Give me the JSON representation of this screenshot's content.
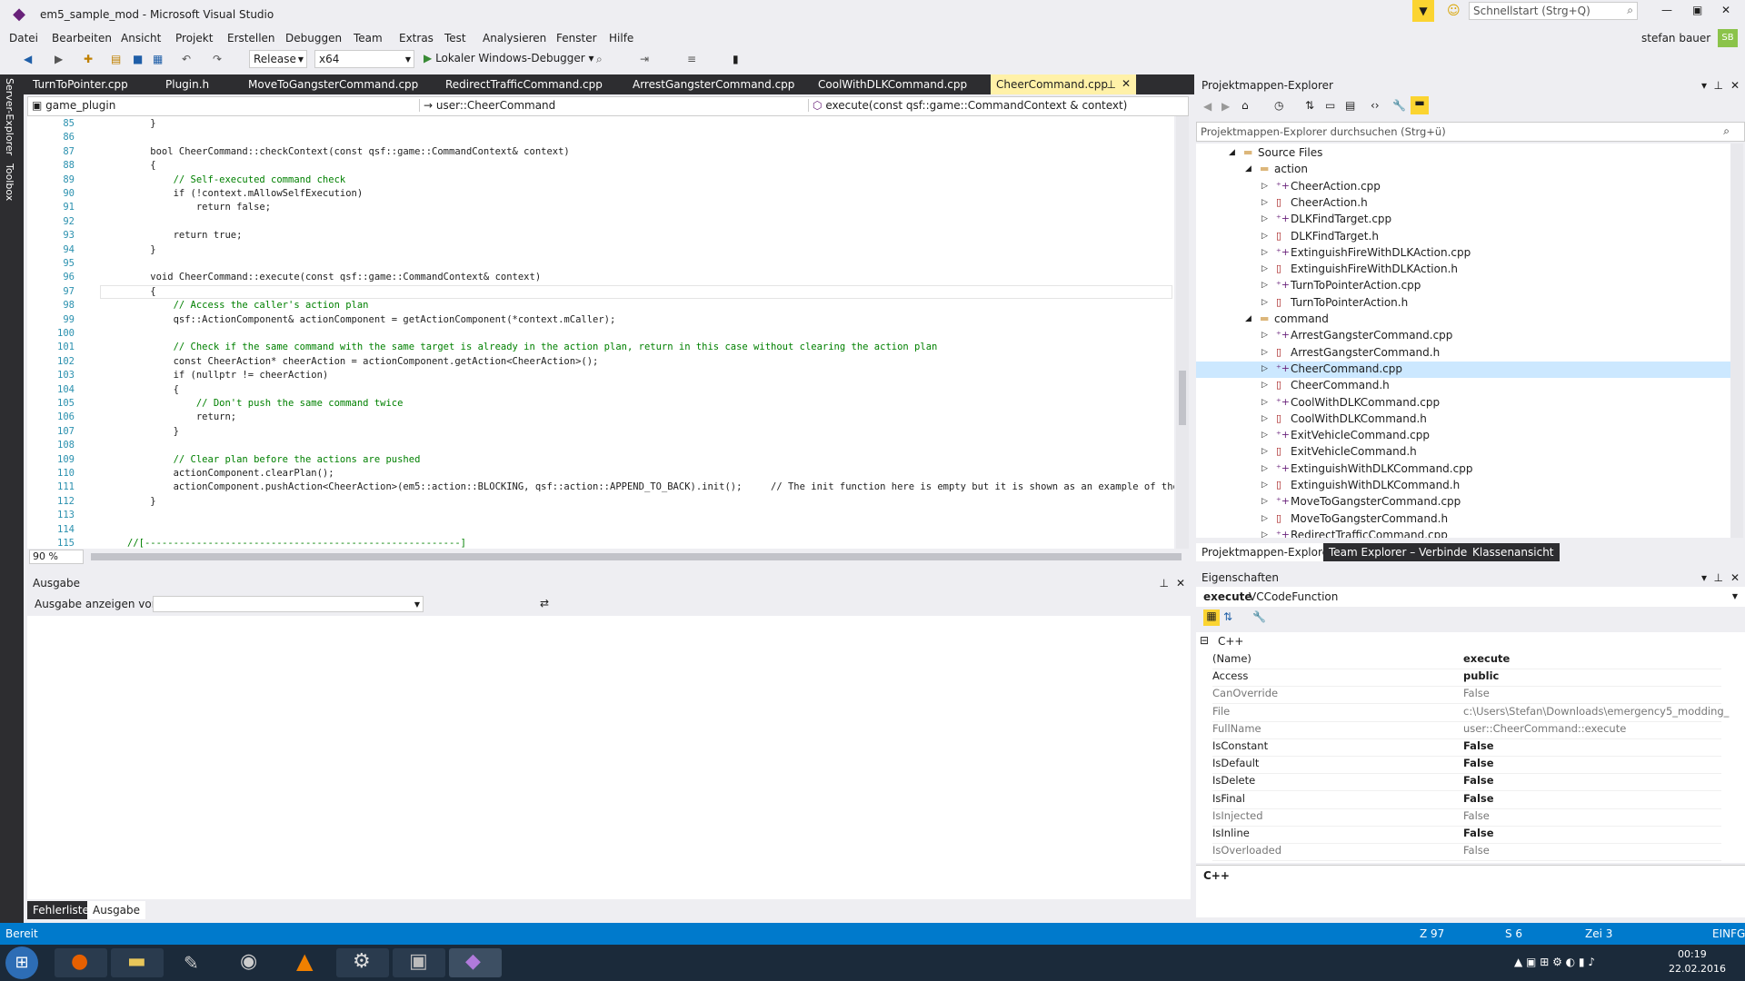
{
  "window": {
    "title": "em5_sample_mod - Microsoft Visual Studio",
    "quicklaunch": "Schnellstart (Strg+Q)",
    "user": "stefan bauer",
    "user_initials": "SB"
  },
  "menu": [
    "Datei",
    "Bearbeiten",
    "Ansicht",
    "Projekt",
    "Erstellen",
    "Debuggen",
    "Team",
    "Extras",
    "Test",
    "Analysieren",
    "Fenster",
    "Hilfe"
  ],
  "toolbar": {
    "config": "Release",
    "platform": "x64",
    "debugger": "Lokaler Windows-Debugger"
  },
  "sidestrip": {
    "server_explorer": "Server-Explorer",
    "toolbox": "Toolbox"
  },
  "tabs": [
    "TurnToPointer.cpp",
    "Plugin.h",
    "MoveToGangsterCommand.cpp",
    "RedirectTrafficCommand.cpp",
    "ArrestGangsterCommand.cpp",
    "CoolWithDLKCommand.cpp"
  ],
  "active_tab": "CheerCommand.cpp",
  "nav": {
    "project": "game_plugin",
    "scope": "user::CheerCommand",
    "member": "execute(const qsf::game::CommandContext & context)"
  },
  "code": [
    {
      "n": "85",
      "t": "    }"
    },
    {
      "n": "86",
      "t": ""
    },
    {
      "n": "87",
      "t": "    bool CheerCommand::checkContext(const qsf::game::CommandContext& context)"
    },
    {
      "n": "88",
      "t": "    {"
    },
    {
      "n": "89",
      "t": "        // Self-executed command check"
    },
    {
      "n": "90",
      "t": "        if (!context.mAllowSelfExecution)"
    },
    {
      "n": "91",
      "t": "            return false;"
    },
    {
      "n": "92",
      "t": ""
    },
    {
      "n": "93",
      "t": "        return true;"
    },
    {
      "n": "94",
      "t": "    }"
    },
    {
      "n": "95",
      "t": ""
    },
    {
      "n": "96",
      "t": "    void CheerCommand::execute(const qsf::game::CommandContext& context)"
    },
    {
      "n": "97",
      "t": "    {"
    },
    {
      "n": "98",
      "t": "        // Access the caller's action plan"
    },
    {
      "n": "99",
      "t": "        qsf::ActionComponent& actionComponent = getActionComponent(*context.mCaller);"
    },
    {
      "n": "100",
      "t": ""
    },
    {
      "n": "101",
      "t": "        // Check if the same command with the same target is already in the action plan, return in this case without clearing the action plan"
    },
    {
      "n": "102",
      "t": "        const CheerAction* cheerAction = actionComponent.getAction<CheerAction>();"
    },
    {
      "n": "103",
      "t": "        if (nullptr != cheerAction)"
    },
    {
      "n": "104",
      "t": "        {"
    },
    {
      "n": "105",
      "t": "            // Don't push the same command twice"
    },
    {
      "n": "106",
      "t": "            return;"
    },
    {
      "n": "107",
      "t": "        }"
    },
    {
      "n": "108",
      "t": ""
    },
    {
      "n": "109",
      "t": "        // Clear plan before the actions are pushed"
    },
    {
      "n": "110",
      "t": "        actionComponent.clearPlan();"
    },
    {
      "n": "111",
      "t": "        actionComponent.pushAction<CheerAction>(em5::action::BLOCKING, qsf::action::APPEND_TO_BACK).init();     // The init function here is empty but it is shown as an example of the"
    },
    {
      "n": "112",
      "t": "    }"
    },
    {
      "n": "113",
      "t": ""
    },
    {
      "n": "114",
      "t": ""
    },
    {
      "n": "115",
      "t": "//[-------------------------------------------------------]"
    }
  ],
  "zoom": "90 %",
  "output": {
    "title": "Ausgabe",
    "show_from": "Ausgabe anzeigen von:"
  },
  "bottom_tabs": [
    "Fehlerliste",
    "Ausgabe"
  ],
  "solution": {
    "title": "Projektmappen-Explorer",
    "search": "Projektmappen-Explorer durchsuchen (Strg+ü)",
    "tree": [
      {
        "label": "Source Files",
        "lvl": 1,
        "kind": "folder",
        "open": true
      },
      {
        "label": "action",
        "lvl": 2,
        "kind": "folder",
        "open": true
      },
      {
        "label": "CheerAction.cpp",
        "lvl": 3,
        "kind": "cpp"
      },
      {
        "label": "CheerAction.h",
        "lvl": 3,
        "kind": "h"
      },
      {
        "label": "DLKFindTarget.cpp",
        "lvl": 3,
        "kind": "cpp"
      },
      {
        "label": "DLKFindTarget.h",
        "lvl": 3,
        "kind": "h"
      },
      {
        "label": "ExtinguishFireWithDLKAction.cpp",
        "lvl": 3,
        "kind": "cpp"
      },
      {
        "label": "ExtinguishFireWithDLKAction.h",
        "lvl": 3,
        "kind": "h"
      },
      {
        "label": "TurnToPointerAction.cpp",
        "lvl": 3,
        "kind": "cpp"
      },
      {
        "label": "TurnToPointerAction.h",
        "lvl": 3,
        "kind": "h"
      },
      {
        "label": "command",
        "lvl": 2,
        "kind": "folder",
        "open": true
      },
      {
        "label": "ArrestGangsterCommand.cpp",
        "lvl": 3,
        "kind": "cpp"
      },
      {
        "label": "ArrestGangsterCommand.h",
        "lvl": 3,
        "kind": "h"
      },
      {
        "label": "CheerCommand.cpp",
        "lvl": 3,
        "kind": "cpp",
        "selected": true
      },
      {
        "label": "CheerCommand.h",
        "lvl": 3,
        "kind": "h"
      },
      {
        "label": "CoolWithDLKCommand.cpp",
        "lvl": 3,
        "kind": "cpp"
      },
      {
        "label": "CoolWithDLKCommand.h",
        "lvl": 3,
        "kind": "h"
      },
      {
        "label": "ExitVehicleCommand.cpp",
        "lvl": 3,
        "kind": "cpp"
      },
      {
        "label": "ExitVehicleCommand.h",
        "lvl": 3,
        "kind": "h"
      },
      {
        "label": "ExtinguishWithDLKCommand.cpp",
        "lvl": 3,
        "kind": "cpp"
      },
      {
        "label": "ExtinguishWithDLKCommand.h",
        "lvl": 3,
        "kind": "h"
      },
      {
        "label": "MoveToGangsterCommand.cpp",
        "lvl": 3,
        "kind": "cpp"
      },
      {
        "label": "MoveToGangsterCommand.h",
        "lvl": 3,
        "kind": "h"
      },
      {
        "label": "RedirectTrafficCommand.cpp",
        "lvl": 3,
        "kind": "cpp"
      }
    ],
    "tabs": [
      "Projektmappen-Explorer",
      "Team Explorer – Verbinden",
      "Klassenansicht"
    ]
  },
  "properties": {
    "title": "Eigenschaften",
    "object": "execute",
    "object_type": "VCCodeFunction",
    "category": "C++",
    "rows": [
      {
        "name": "(Name)",
        "value": "execute",
        "bold": true
      },
      {
        "name": "Access",
        "value": "public",
        "bold": true
      },
      {
        "name": "CanOverride",
        "value": "False",
        "bold": false
      },
      {
        "name": "File",
        "value": "c:\\Users\\Stefan\\Downloads\\emergency5_modding_",
        "bold": false
      },
      {
        "name": "FullName",
        "value": "user::CheerCommand::execute",
        "bold": false
      },
      {
        "name": "IsConstant",
        "value": "False",
        "bold": true
      },
      {
        "name": "IsDefault",
        "value": "False",
        "bold": true
      },
      {
        "name": "IsDelete",
        "value": "False",
        "bold": true
      },
      {
        "name": "IsFinal",
        "value": "False",
        "bold": true
      },
      {
        "name": "IsInjected",
        "value": "False",
        "bold": false
      },
      {
        "name": "IsInline",
        "value": "False",
        "bold": true
      },
      {
        "name": "IsOverloaded",
        "value": "False",
        "bold": false
      }
    ],
    "description": "C++"
  },
  "status": {
    "ready": "Bereit",
    "line": "Z 97",
    "col": "S 6",
    "char": "Zei 3",
    "mode": "EINFG"
  },
  "taskbar": {
    "time": "00:19",
    "date": "22.02.2016"
  },
  "colors": {
    "accent": "#007acc",
    "active_tab": "#fff1a8",
    "keyword": "#0000ff",
    "type": "#2b91af",
    "comment": "#008000"
  }
}
